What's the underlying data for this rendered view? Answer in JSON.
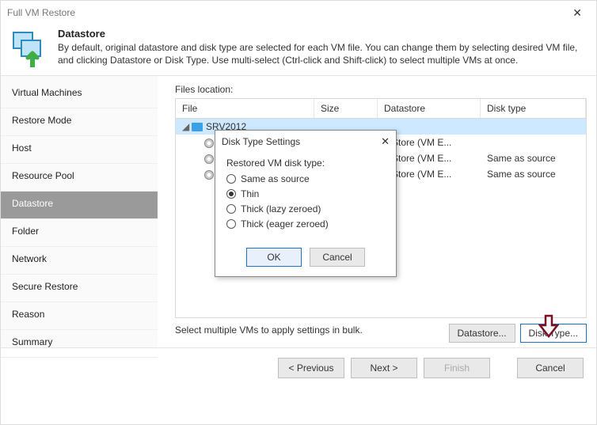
{
  "window": {
    "title": "Full VM Restore"
  },
  "header": {
    "title": "Datastore",
    "description": "By default, original datastore and disk type are selected for each VM file. You can change them by selecting desired VM file, and clicking Datastore or Disk Type. Use multi-select (Ctrl-click and Shift-click) to select multiple VMs at once."
  },
  "sidebar": {
    "items": [
      {
        "label": "Virtual Machines",
        "active": false
      },
      {
        "label": "Restore Mode",
        "active": false
      },
      {
        "label": "Host",
        "active": false
      },
      {
        "label": "Resource Pool",
        "active": false
      },
      {
        "label": "Datastore",
        "active": true
      },
      {
        "label": "Folder",
        "active": false
      },
      {
        "label": "Network",
        "active": false
      },
      {
        "label": "Secure Restore",
        "active": false
      },
      {
        "label": "Reason",
        "active": false
      },
      {
        "label": "Summary",
        "active": false
      }
    ]
  },
  "main": {
    "files_label": "Files location:",
    "columns": {
      "file": "File",
      "size": "Size",
      "datastore": "Datastore",
      "disktype": "Disk type"
    },
    "rows": [
      {
        "file": "SRV2012",
        "indent": 0,
        "icon": "vm",
        "size": "",
        "datastore": "",
        "disktype": "",
        "selected": true,
        "expandable": true
      },
      {
        "file": "",
        "indent": 1,
        "icon": "disk",
        "size": "",
        "datastore": "taStore (VM E...",
        "disktype": "",
        "selected": false
      },
      {
        "file": "",
        "indent": 1,
        "icon": "disk",
        "size": "",
        "datastore": "taStore (VM E...",
        "disktype": "Same as source",
        "selected": false
      },
      {
        "file": "",
        "indent": 1,
        "icon": "disk",
        "size": "",
        "datastore": "taStore (VM E...",
        "disktype": "Same as source",
        "selected": false
      }
    ],
    "hint": "Select multiple VMs to apply settings in bulk.",
    "datastore_btn": "Datastore...",
    "disktype_btn": "Disk Type..."
  },
  "modal": {
    "title": "Disk Type Settings",
    "group_label": "Restored VM disk type:",
    "options": [
      {
        "label": "Same as source",
        "checked": false
      },
      {
        "label": "Thin",
        "checked": true
      },
      {
        "label": "Thick (lazy zeroed)",
        "checked": false
      },
      {
        "label": "Thick (eager zeroed)",
        "checked": false
      }
    ],
    "ok": "OK",
    "cancel": "Cancel"
  },
  "wizard": {
    "previous": "< Previous",
    "next": "Next >",
    "finish": "Finish",
    "cancel": "Cancel"
  }
}
